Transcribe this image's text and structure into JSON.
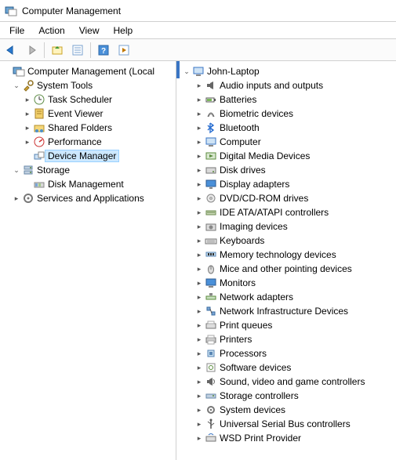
{
  "window": {
    "title": "Computer Management"
  },
  "menu": {
    "file": "File",
    "action": "Action",
    "view": "View",
    "help": "Help"
  },
  "leftTree": {
    "root": "Computer Management (Local",
    "systemTools": "System Tools",
    "taskScheduler": "Task Scheduler",
    "eventViewer": "Event Viewer",
    "sharedFolders": "Shared Folders",
    "performance": "Performance",
    "deviceManager": "Device Manager",
    "storage": "Storage",
    "diskManagement": "Disk Management",
    "servicesApps": "Services and Applications"
  },
  "rightTree": {
    "root": "John-Laptop",
    "items": [
      "Audio inputs and outputs",
      "Batteries",
      "Biometric devices",
      "Bluetooth",
      "Computer",
      "Digital Media Devices",
      "Disk drives",
      "Display adapters",
      "DVD/CD-ROM drives",
      "IDE ATA/ATAPI controllers",
      "Imaging devices",
      "Keyboards",
      "Memory technology devices",
      "Mice and other pointing devices",
      "Monitors",
      "Network adapters",
      "Network Infrastructure Devices",
      "Print queues",
      "Printers",
      "Processors",
      "Software devices",
      "Sound, video and game controllers",
      "Storage controllers",
      "System devices",
      "Universal Serial Bus controllers",
      "WSD Print Provider"
    ]
  },
  "deviceIcons": [
    "speaker-icon",
    "battery-icon",
    "fingerprint-icon",
    "bluetooth-icon",
    "computer-icon",
    "media-icon",
    "disk-icon",
    "display-icon",
    "dvd-icon",
    "ide-icon",
    "camera-icon",
    "keyboard-icon",
    "memory-icon",
    "mouse-icon",
    "monitor-icon",
    "network-icon",
    "netinfra-icon",
    "printqueue-icon",
    "printer-icon",
    "cpu-icon",
    "software-icon",
    "sound-icon",
    "storage-icon",
    "gear-icon",
    "usb-icon",
    "wsd-icon"
  ]
}
